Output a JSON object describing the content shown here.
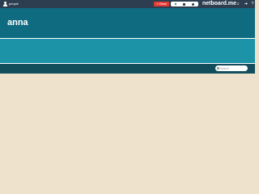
{
  "topbar": {
    "user": {
      "icon": "user-icon",
      "label": "people"
    },
    "share": {
      "icon": "share-icon",
      "label": "Share"
    },
    "stats": [
      {
        "icon": "filter-icon",
        "value": ""
      },
      {
        "icon": "lock-icon",
        "value": ""
      },
      {
        "icon": "eye-icon",
        "value": ""
      }
    ],
    "brand": "netboard.me",
    "sound": {
      "icon": "speaker-icon"
    },
    "login": {
      "icon": "login-icon"
    },
    "help": {
      "icon": "help-icon",
      "label": "?"
    }
  },
  "header": {
    "title": "anna"
  },
  "toolbar": {
    "search": {
      "icon": "search-icon",
      "placeholder": "Search"
    }
  },
  "colors": {
    "topbar": "#2c3e50",
    "header": "#0e6b80",
    "band": "#1d93a8",
    "toolbar": "#134c5b",
    "content": "#efe2cd",
    "share": "#e53935"
  }
}
